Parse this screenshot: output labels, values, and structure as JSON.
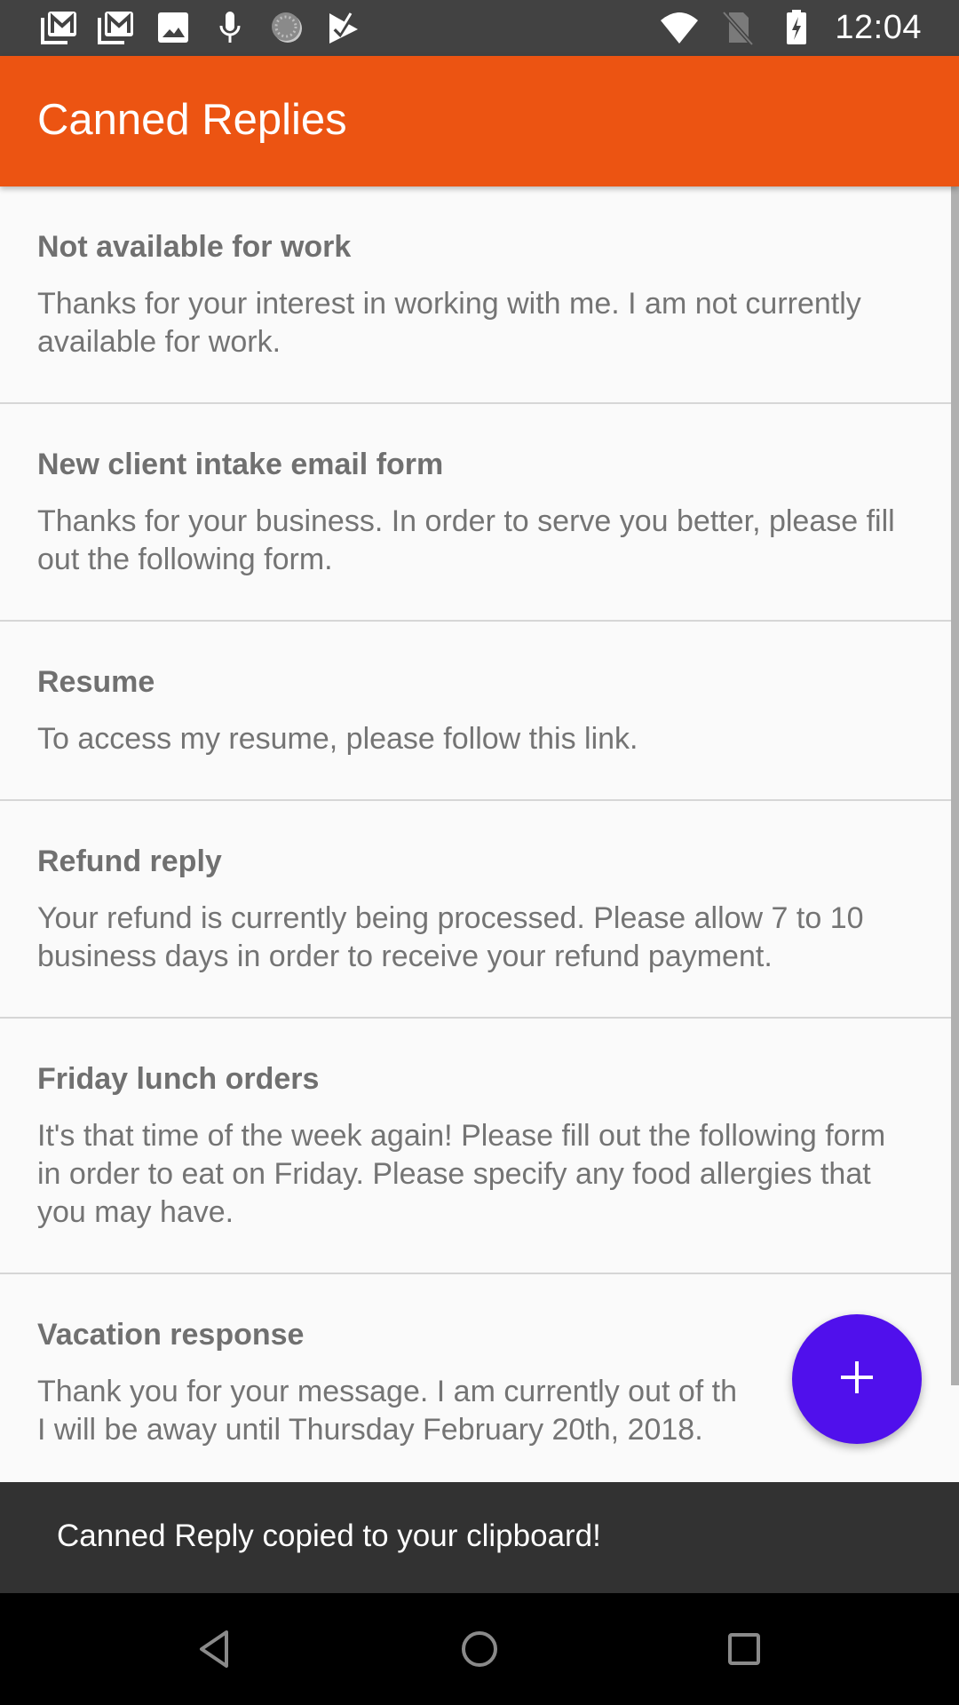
{
  "status_bar": {
    "time": "12:04",
    "left_icons": [
      "gmail-icon",
      "gmail-icon",
      "image-icon",
      "mic-icon",
      "sync-icon",
      "play-store-check-icon"
    ],
    "right_icons": [
      "wifi-icon",
      "no-sim-icon",
      "battery-charging-icon"
    ]
  },
  "app_bar": {
    "title": "Canned Replies",
    "color": "#ec5412"
  },
  "replies": [
    {
      "title": "Not available for work",
      "body": "Thanks for your interest in working with me. I am not currently available for work."
    },
    {
      "title": "New client intake email form",
      "body": "Thanks for your business. In order to serve you better, please fill out the following form."
    },
    {
      "title": "Resume",
      "body": "To access my resume, please follow this link."
    },
    {
      "title": "Refund reply",
      "body": "Your refund is currently being processed. Please allow 7 to 10 business days in order to receive your refund payment."
    },
    {
      "title": "Friday lunch orders",
      "body": "It's that time of the week again! Please fill out the following form in order to eat on Friday. Please specify any food allergies that you may have."
    },
    {
      "title": "Vacation response",
      "body_line1": "Thank you for your message. I am currently out of th",
      "body_line2": "I will be away until Thursday February 20th, 2018."
    }
  ],
  "fab": {
    "icon": "plus-icon",
    "label": "Add canned reply",
    "color": "#5010ec"
  },
  "snackbar": {
    "message": "Canned Reply copied to your clipboard!"
  },
  "nav_bar": {
    "buttons": [
      "back",
      "home",
      "recents"
    ]
  }
}
